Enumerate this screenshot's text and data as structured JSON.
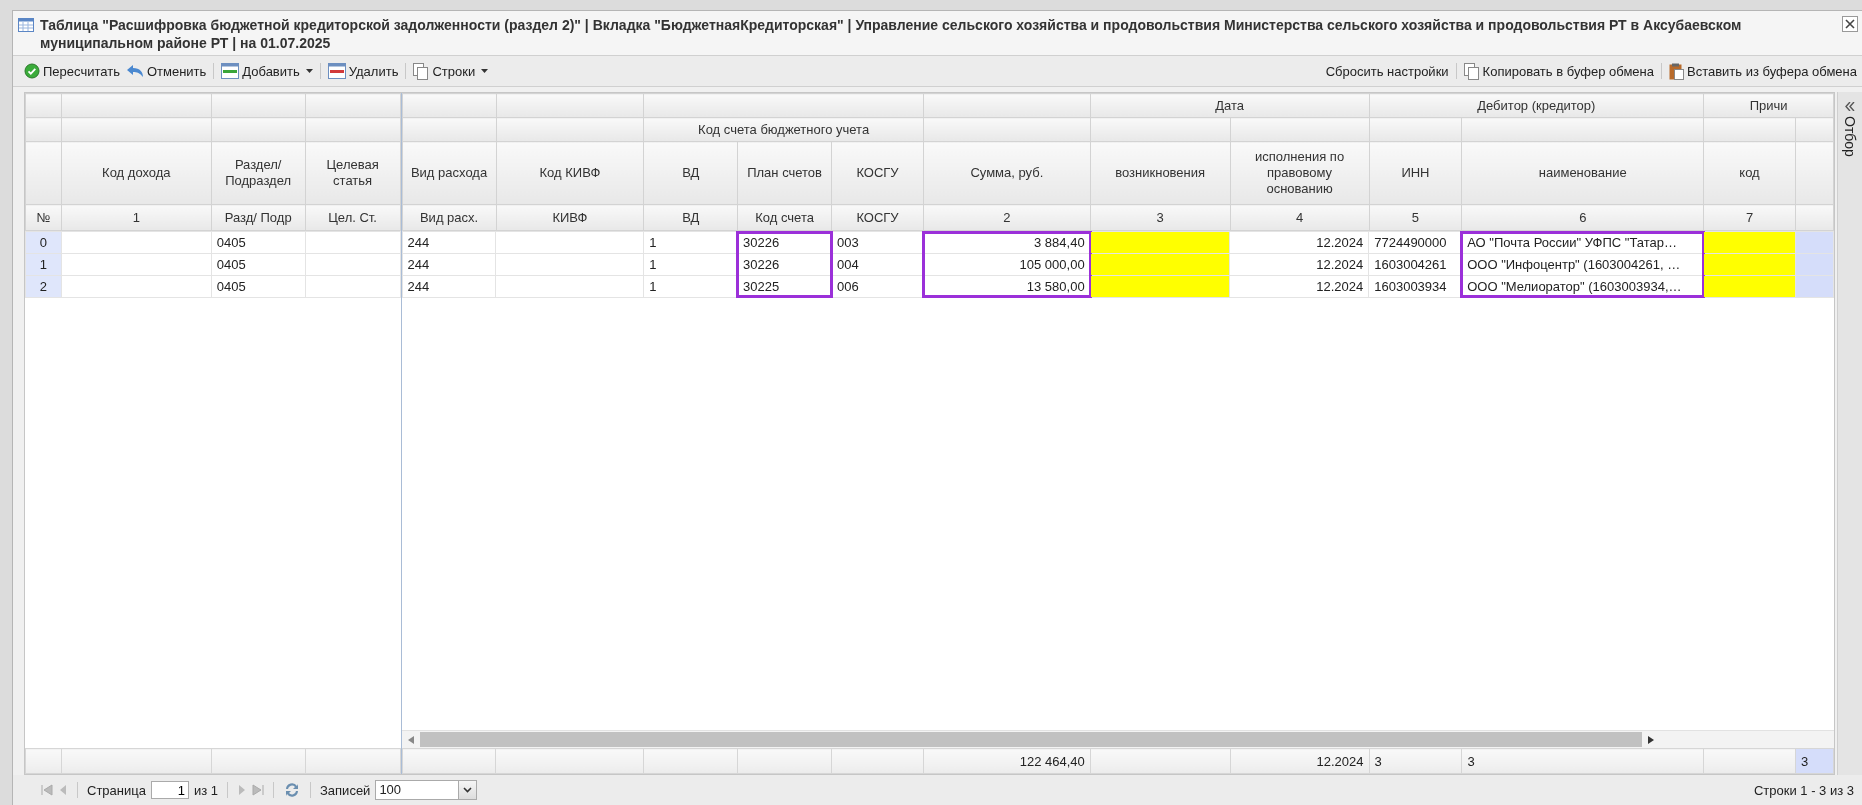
{
  "window": {
    "title": "Таблица \"Расшифровка бюджетной кредиторской задолженности (раздел 2)\" | Вкладка \"БюджетнаяКредиторская\" | Управление сельского хозяйства и продовольствия Министерства сельского хозяйства и продовольствия РТ в Аксубаевском муниципальном районе РТ | на 01.07.2025"
  },
  "toolbar": {
    "left": [
      {
        "label": "Пересчитать",
        "kind": "recalc",
        "dropdown": false
      },
      {
        "label": "Отменить",
        "kind": "undo",
        "dropdown": false
      },
      {
        "label": "Добавить",
        "kind": "add",
        "dropdown": true
      },
      {
        "label": "Удалить",
        "kind": "delete",
        "dropdown": false
      },
      {
        "label": "Строки",
        "kind": "rows",
        "dropdown": true
      }
    ],
    "right": [
      {
        "label": "Сбросить настройки",
        "kind": "reset",
        "dropdown": false
      },
      {
        "label": "Копировать в буфер обмена",
        "kind": "copy",
        "dropdown": false
      },
      {
        "label": "Вставить из буфера обмена",
        "kind": "paste",
        "dropdown": false
      }
    ]
  },
  "grid": {
    "locked": {
      "columns": [
        {
          "number": "№",
          "kind": "index"
        },
        {
          "header": "Код дохода",
          "number": "1",
          "kind": "text"
        },
        {
          "header": "Раздел/ Подраздел",
          "number": "Разд/ Подр",
          "kind": "text"
        },
        {
          "header": "Целевая статья",
          "number": "Цел. Ст.",
          "kind": "text"
        }
      ]
    },
    "scrollable": {
      "group_headers": [
        "Дата",
        "Дебитор (кредитор)",
        "Причи"
      ],
      "subgroup_headers": [
        "Код счета бюджетного учета"
      ],
      "columns": [
        {
          "header": "Вид расхода",
          "number": "Вид расх.",
          "kind": "text",
          "required": false,
          "highlighted": false
        },
        {
          "header": "Код КИВФ",
          "number": "КИВФ",
          "kind": "text",
          "required": false,
          "highlighted": false
        },
        {
          "header": "ВД",
          "number": "ВД",
          "kind": "text",
          "required": false,
          "highlighted": false
        },
        {
          "header": "План счетов",
          "number": "Код счета",
          "kind": "text",
          "required": false,
          "highlighted": true
        },
        {
          "header": "КОСГУ",
          "number": "КОСГУ",
          "kind": "text",
          "required": false,
          "highlighted": false
        },
        {
          "header": "Сумма, руб.",
          "number": "2",
          "kind": "amount",
          "required": false,
          "highlighted": true
        },
        {
          "header": "возникновения",
          "number": "3",
          "kind": "date",
          "required": true,
          "highlighted": false
        },
        {
          "header": "исполнения по правовому основанию",
          "number": "4",
          "kind": "date",
          "required": false,
          "highlighted": false
        },
        {
          "header": "ИНН",
          "number": "5",
          "kind": "text",
          "required": false,
          "highlighted": false
        },
        {
          "header": "наименование",
          "number": "6",
          "kind": "text",
          "required": false,
          "highlighted": true
        },
        {
          "header": "код",
          "number": "7",
          "kind": "text",
          "required": true,
          "highlighted": false
        },
        {
          "kind": "marker",
          "required": false,
          "highlighted": false
        }
      ]
    },
    "rows": [
      {
        "number": "0",
        "section": "0405",
        "expense_type": "244",
        "vd": "1",
        "account": "30226",
        "kosgu": "003",
        "amount": "3 884,40",
        "execution_date": "12.2024",
        "inn": "7724490000",
        "name": "АО \"Почта России\" УФПС \"Татар…"
      },
      {
        "number": "1",
        "section": "0405",
        "expense_type": "244",
        "vd": "1",
        "account": "30226",
        "kosgu": "004",
        "amount": "105 000,00",
        "execution_date": "12.2024",
        "inn": "1603004261",
        "name": "ООО \"Инфоцентр\" (1603004261, …"
      },
      {
        "number": "2",
        "section": "0405",
        "expense_type": "244",
        "vd": "1",
        "account": "30225",
        "kosgu": "006",
        "amount": "13 580,00",
        "execution_date": "12.2024",
        "inn": "1603003934",
        "name": "ООО \"Мелиоратор\" (1603003934,…"
      }
    ],
    "summary": {
      "amount": "122 464,40",
      "execution_date": "12.2024",
      "inn": "3",
      "name": "3",
      "marker": "3"
    }
  },
  "side_panel": {
    "label": "Отбор"
  },
  "pager": {
    "page_label": "Страница",
    "page": "1",
    "of": "из 1",
    "size_label": "Записей",
    "size": "100",
    "info": "Строки 1 - 3 из 3"
  }
}
